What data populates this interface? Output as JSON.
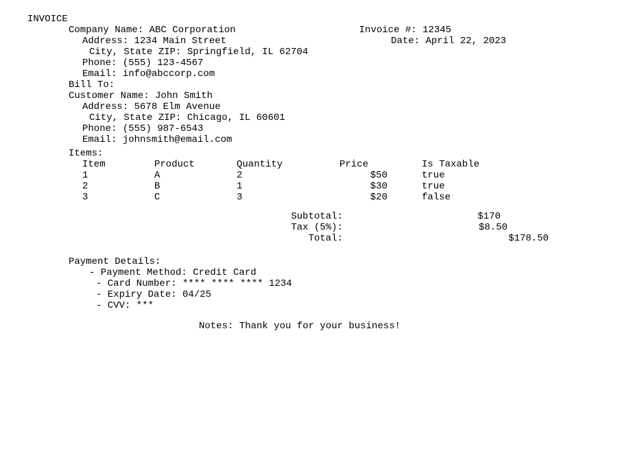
{
  "title": "INVOICE",
  "company": {
    "name_label": "Company Name: ",
    "name": "ABC Corporation",
    "address_label": "Address: ",
    "address": "1234 Main Street",
    "csz_label": "City, State ZIP: ",
    "csz": "Springfield, IL 62704",
    "phone_label": "Phone: ",
    "phone": "(555) 123-4567",
    "email_label": "Email: ",
    "email": "info@abccorp.com"
  },
  "invoice": {
    "number_label": "Invoice #: ",
    "number": "12345",
    "date_label": "Date: ",
    "date": "April 22, 2023"
  },
  "bill_to_label": "Bill To:",
  "customer": {
    "name_label": "Customer Name: ",
    "name": "John Smith",
    "address_label": "Address: ",
    "address": "5678 Elm Avenue",
    "csz_label": "City, State ZIP: ",
    "csz": "Chicago, IL 60601",
    "phone_label": "Phone: ",
    "phone": "(555) 987-6543",
    "email_label": "Email: ",
    "email": "johnsmith@email.com"
  },
  "items_label": "Items:",
  "headers": {
    "item": "Item",
    "product": "Product",
    "qty": "Quantity",
    "price": "Price",
    "taxable": "Is Taxable"
  },
  "items": [
    {
      "n": "1",
      "product": "A",
      "qty": "2",
      "price": "$50",
      "taxable": "true"
    },
    {
      "n": "2",
      "product": "B",
      "qty": "1",
      "price": "$30",
      "taxable": "true"
    },
    {
      "n": "3",
      "product": "C",
      "qty": "3",
      "price": "$20",
      "taxable": "false"
    }
  ],
  "totals": {
    "subtotal_label": "Subtotal:",
    "subtotal": "$170",
    "tax_label": "Tax (5%):",
    "tax": "$8.50",
    "total_label": "Total:",
    "total": "$178.50"
  },
  "payment": {
    "heading": "Payment Details:",
    "method": "- Payment Method: Credit Card",
    "card": "- Card Number: **** **** **** 1234",
    "expiry": "- Expiry Date: 04/25",
    "cvv": "- CVV: ***"
  },
  "notes_label": "Notes: ",
  "notes": "Thank you for your business!"
}
